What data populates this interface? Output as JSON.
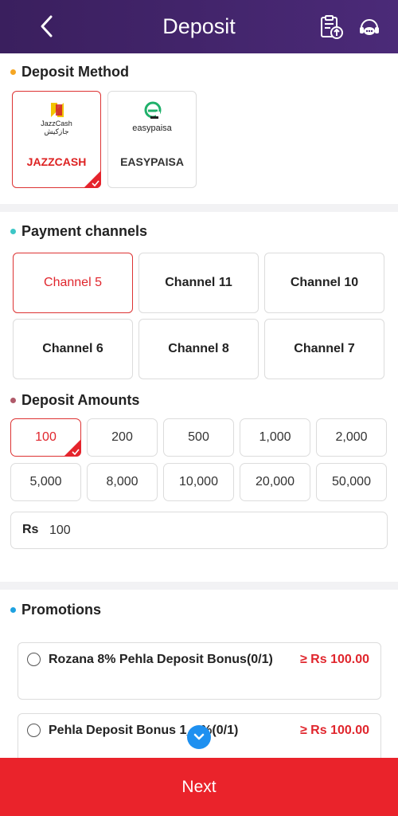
{
  "header": {
    "title": "Deposit",
    "back_icon": "chevron-left-icon",
    "history_icon": "clipboard-upload-icon",
    "support_icon": "support-chat-icon"
  },
  "deposit_method": {
    "title": "Deposit Method",
    "dot_color": "#f5a623",
    "methods": [
      {
        "label": "JAZZCASH",
        "logo_text_1": "JazzCash",
        "logo_text_2": "جازکیش",
        "selected": true
      },
      {
        "label": "EASYPAISA",
        "logo_text": "easypaisa",
        "selected": false
      }
    ]
  },
  "payment_channels": {
    "title": "Payment channels",
    "dot_color": "#3cc6c6",
    "channels": [
      "Channel 5",
      "Channel 11",
      "Channel 10",
      "Channel 6",
      "Channel 8",
      "Channel 7"
    ],
    "selected": "Channel 5"
  },
  "deposit_amounts": {
    "title": "Deposit Amounts",
    "dot_color": "#b05a6a",
    "amounts": [
      "100",
      "200",
      "500",
      "1,000",
      "2,000",
      "5,000",
      "8,000",
      "10,000",
      "20,000",
      "50,000"
    ],
    "selected": "100",
    "currency_label": "Rs",
    "input_value": "100"
  },
  "promotions": {
    "title": "Promotions",
    "dot_color": "#1ea1e0",
    "items": [
      {
        "name": "Rozana 8% Pehla Deposit Bonus(0/1)",
        "min": "≥ Rs 100.00"
      },
      {
        "name": "Pehla Deposit Bonus 1__%(0/1)",
        "min": "≥ Rs 100.00"
      }
    ]
  },
  "footer": {
    "next_label": "Next"
  },
  "colors": {
    "header_bg": "#4b2a78",
    "accent_red": "#e0262d",
    "next_bg": "#ea232b",
    "fab_blue": "#1e90f0"
  }
}
